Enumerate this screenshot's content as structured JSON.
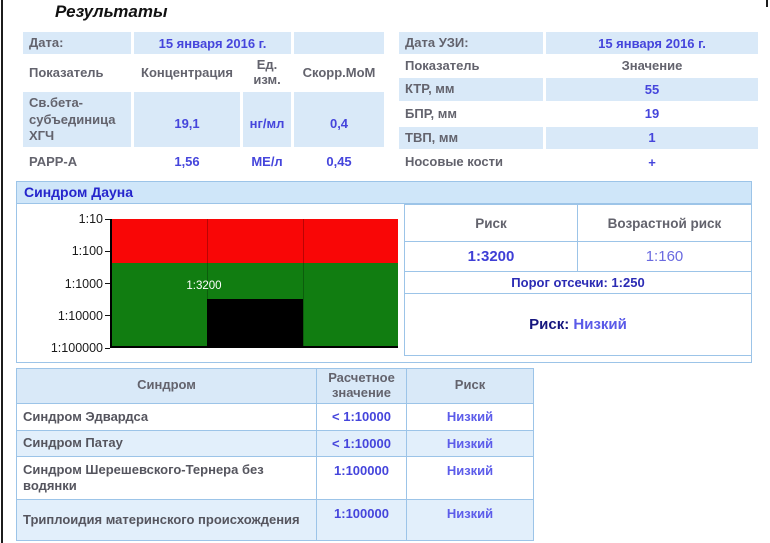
{
  "page": {
    "title": "Результаты"
  },
  "biochem": {
    "date_label": "Дата:",
    "date_value": "15 января 2016 г.",
    "headers": [
      "Показатель",
      "Концентрация",
      "Ед. изм.",
      "Скорр.МоМ"
    ],
    "rows": [
      {
        "name": "Св.бета-субъединица ХГЧ",
        "concentration": "19,1",
        "unit": "нг/мл",
        "mom": "0,4"
      },
      {
        "name": "PAPP-A",
        "concentration": "1,56",
        "unit": "МЕ/л",
        "mom": "0,45"
      }
    ]
  },
  "ultrasound": {
    "date_label": "Дата УЗИ:",
    "date_value": "15 января 2016 г.",
    "headers": [
      "Показатель",
      "Значение"
    ],
    "rows": [
      {
        "name": "КТР, мм",
        "value": "55"
      },
      {
        "name": "БПР, мм",
        "value": "19"
      },
      {
        "name": "ТВП, мм",
        "value": "1"
      },
      {
        "name": "Носовые кости",
        "value": "+"
      }
    ]
  },
  "down": {
    "title": "Синдром Дауна",
    "risk_header": "Риск",
    "age_risk_header": "Возрастной риск",
    "risk_value": "1:3200",
    "age_risk_value": "1:160",
    "cutoff_text": "Порог отсечки: 1:250",
    "risk_label": "Риск:",
    "risk_level": "Низкий"
  },
  "chart_data": {
    "type": "bar",
    "title": "Синдром Дауна",
    "y_scale": "log",
    "y_axis_ticks": [
      "1:10",
      "1:100",
      "1:1000",
      "1:10000",
      "1:100000"
    ],
    "y_top_denominator": 10,
    "y_bottom_denominator": 100000,
    "cutoff": {
      "label": "1:250",
      "denominator": 250
    },
    "bar": {
      "label": "1:3200",
      "denominator": 3200
    },
    "zones": {
      "high_risk_color": "#f90606",
      "low_risk_color": "#117d11"
    },
    "bar_color": "#000000",
    "grid": "vertical-thirds",
    "legend": "none"
  },
  "syndromes": {
    "headers": [
      "Синдром",
      "Расчетное значение",
      "Риск"
    ],
    "rows": [
      {
        "name": "Синдром Эдвардса",
        "value": "< 1:10000",
        "risk": "Низкий"
      },
      {
        "name": "Синдром Патау",
        "value": "< 1:10000",
        "risk": "Низкий"
      },
      {
        "name": "Синдром Шерешевского-Тернера без водянки",
        "value": "1:100000",
        "risk": "Низкий"
      },
      {
        "name": "Триплоидия материнского происхождения",
        "value": "1:100000",
        "risk": "Низкий"
      }
    ]
  },
  "colors": {
    "accent_value_blue": "#4545dc",
    "row_bg_blue": "#d9e9f8",
    "table_border_blue": "#9cc4e8",
    "section_header_bg": "#cfe6f9",
    "section_title_blue": "#2525cc",
    "label_gray": "#63636d",
    "risk_high_red": "#f90606",
    "risk_low_green": "#117d11",
    "dark_navy": "#16167e",
    "risk_level_blue": "#5a5ae8",
    "frame_black": "#1c1c1c"
  }
}
